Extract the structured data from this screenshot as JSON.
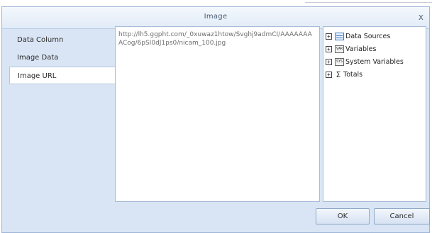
{
  "dialog": {
    "title": "Image",
    "close_label": "x"
  },
  "sidebar": {
    "items": [
      {
        "label": "Data Column",
        "active": false
      },
      {
        "label": "Image Data",
        "active": false
      },
      {
        "label": "Image URL",
        "active": true
      }
    ]
  },
  "url_panel": {
    "value": "http://lh5.ggpht.com/_0xuwaz1htow/Svghj9admCI/AAAAAAAACog/6pSI0dJ1ps0/nicam_100.jpg"
  },
  "tree": {
    "items": [
      {
        "label": "Data Sources",
        "icon": "data-sources-icon"
      },
      {
        "label": "Variables",
        "icon": "variables-icon"
      },
      {
        "label": "System Variables",
        "icon": "system-variables-icon"
      },
      {
        "label": "Totals",
        "icon": "sigma-icon"
      }
    ],
    "expand_symbol": "+"
  },
  "buttons": {
    "ok": "OK",
    "cancel": "Cancel"
  },
  "colors": {
    "dialog_bg": "#d9e5f4",
    "border": "#9db5d6",
    "accent": "#3a78c4"
  }
}
